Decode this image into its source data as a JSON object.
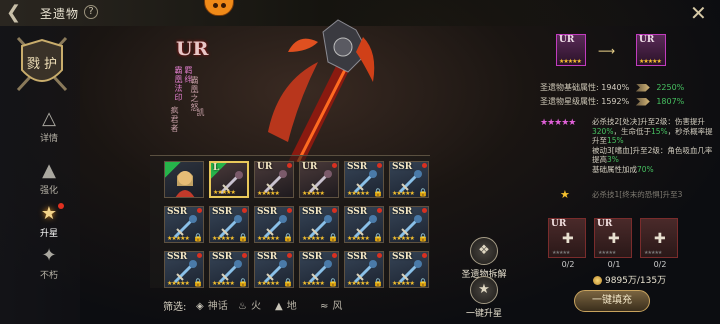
{
  "header": {
    "title": "圣遗物",
    "help_icon": "question-mark-icon",
    "back_icon": "back-arrow-icon",
    "close_icon": "close-x-icon"
  },
  "crest": {
    "text": "戮 护"
  },
  "nav": [
    {
      "label": "详情",
      "icon": "detail-icon",
      "active": false
    },
    {
      "label": "强化",
      "icon": "enhance-icon",
      "active": false
    },
    {
      "label": "升星",
      "icon": "star-up-icon",
      "active": true
    },
    {
      "label": "不朽",
      "icon": "immortal-icon",
      "active": false
    }
  ],
  "hero": {
    "rank": "UR",
    "name_col1": "霸凰法印",
    "name_col2": "羁绊",
    "name_col3": "霸凰之怒",
    "name_col4": "凯",
    "name_col5": "疯君者"
  },
  "grid": {
    "cells": [
      {
        "rank": "",
        "type": "portrait",
        "stars": 0,
        "dot": false,
        "badge": true
      },
      {
        "rank": "L",
        "type": "ur",
        "stars": 5,
        "dot": false,
        "badge": true,
        "selected": true
      },
      {
        "rank": "UR",
        "type": "ur",
        "stars": 5,
        "dot": true
      },
      {
        "rank": "UR",
        "type": "ur",
        "stars": 5,
        "dot": true
      },
      {
        "rank": "SSR",
        "type": "ssr",
        "stars": 5,
        "dot": true
      },
      {
        "rank": "SSR",
        "type": "ssr",
        "stars": 5,
        "dot": true
      },
      {
        "rank": "SSR",
        "type": "ssr",
        "stars": 5,
        "dot": true
      },
      {
        "rank": "SSR",
        "type": "ssr",
        "stars": 5,
        "dot": true
      },
      {
        "rank": "SSR",
        "type": "ssr",
        "stars": 5,
        "dot": true
      },
      {
        "rank": "SSR",
        "type": "ssr",
        "stars": 5,
        "dot": true
      },
      {
        "rank": "SSR",
        "type": "ssr",
        "stars": 5,
        "dot": true
      },
      {
        "rank": "SSR",
        "type": "ssr",
        "stars": 5,
        "dot": true
      },
      {
        "rank": "SSR",
        "type": "ssr",
        "stars": 5,
        "dot": true
      },
      {
        "rank": "SSR",
        "type": "ssr",
        "stars": 5,
        "dot": true
      },
      {
        "rank": "SSR",
        "type": "ssr",
        "stars": 5,
        "dot": true
      },
      {
        "rank": "SSR",
        "type": "ssr",
        "stars": 5,
        "dot": true
      },
      {
        "rank": "SSR",
        "type": "ssr",
        "stars": 5,
        "dot": true
      },
      {
        "rank": "SSR",
        "type": "ssr",
        "stars": 5,
        "dot": true
      }
    ]
  },
  "filter": {
    "label": "筛选:",
    "options": [
      {
        "label": "神话",
        "icon": "myth-icon"
      },
      {
        "label": "火",
        "icon": "fire-icon"
      },
      {
        "label": "地",
        "icon": "earth-icon"
      },
      {
        "label": "风",
        "icon": "wind-icon"
      }
    ]
  },
  "actions": {
    "dismantle": "圣遗物拆解",
    "quick_up": "一键升星"
  },
  "upgrade": {
    "from_rank": "UR",
    "to_rank": "UR",
    "base_label": "圣遗物基础属性:",
    "base_from": "1940%",
    "base_to": "2250%",
    "star_label": "圣遗物星级属性:",
    "star_from": "1592%",
    "star_to": "1807%",
    "stars": "★★★★★",
    "desc1_a": "必杀技2[处决]升至2级：伤害提升",
    "desc1_b": "320%",
    "desc1_c": "，生命低于",
    "desc1_d": "15%",
    "desc1_e": "，秒杀概率提升至",
    "desc1_f": "15%",
    "desc2_a": "被动3[嗜血]升至2级：角色吸血几率提高",
    "desc2_b": "3%",
    "desc3_a": "基础属性加成",
    "desc3_b": "70%",
    "small_star": "★",
    "desc4": "必杀技1[终末的恐惧]升至3"
  },
  "materials": [
    {
      "rank": "UR",
      "count": "0/2"
    },
    {
      "rank": "UR",
      "count": "0/1"
    },
    {
      "rank": "",
      "count": "0/2"
    }
  ],
  "cost": {
    "text": "9895万/135万"
  },
  "fill_button": "一键填充",
  "colors": {
    "accent_gold": "#e8c85a",
    "upgrade_green": "#46c060",
    "ur_frame": "#c13cbe",
    "red_dot": "#d83020"
  }
}
